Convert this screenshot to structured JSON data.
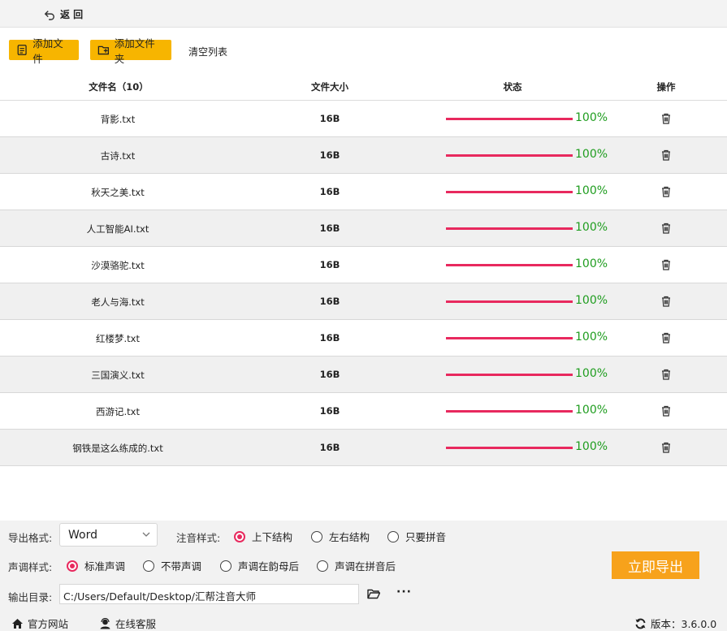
{
  "topbar": {
    "back_label": "返 回"
  },
  "toolbar": {
    "add_file": "添加文件",
    "add_folder": "添加文件夹",
    "clear_list": "清空列表"
  },
  "table": {
    "headers": {
      "name": "文件名（10）",
      "size": "文件大小",
      "status": "状态",
      "action": "操作"
    },
    "rows": [
      {
        "name": "背影.txt",
        "size": "16B",
        "progress": 100,
        "status": "100%"
      },
      {
        "name": "古诗.txt",
        "size": "16B",
        "progress": 100,
        "status": "100%"
      },
      {
        "name": "秋天之美.txt",
        "size": "16B",
        "progress": 100,
        "status": "100%"
      },
      {
        "name": "人工智能AI.txt",
        "size": "16B",
        "progress": 100,
        "status": "100%"
      },
      {
        "name": "沙漠骆驼.txt",
        "size": "16B",
        "progress": 100,
        "status": "100%"
      },
      {
        "name": "老人与海.txt",
        "size": "16B",
        "progress": 100,
        "status": "100%"
      },
      {
        "name": "红楼梦.txt",
        "size": "16B",
        "progress": 100,
        "status": "100%"
      },
      {
        "name": "三国演义.txt",
        "size": "16B",
        "progress": 100,
        "status": "100%"
      },
      {
        "name": "西游记.txt",
        "size": "16B",
        "progress": 100,
        "status": "100%"
      },
      {
        "name": "钢铁是这么练成的.txt",
        "size": "16B",
        "progress": 100,
        "status": "100%"
      }
    ]
  },
  "settings": {
    "format_label": "导出格式:",
    "format_value": "Word",
    "pinyin_style_label": "注音样式:",
    "pinyin_options": [
      "上下结构",
      "左右结构",
      "只要拼音"
    ],
    "pinyin_selected": "上下结构",
    "tone_style_label": "声调样式:",
    "tone_options": [
      "标准声调",
      "不带声调",
      "声调在韵母后",
      "声调在拼音后"
    ],
    "tone_selected": "标准声调",
    "output_label": "输出目录:",
    "output_path": "C:/Users/Default/Desktop/汇帮注音大师",
    "more_label": "···",
    "export_button": "立即导出"
  },
  "footer": {
    "website": "官方网站",
    "support": "在线客服",
    "version": "版本：3.6.0.0"
  },
  "colors": {
    "accent": "#f7b500",
    "export": "#f7a21b",
    "progress": "#e8295e",
    "status_text": "#1f9d1f"
  }
}
